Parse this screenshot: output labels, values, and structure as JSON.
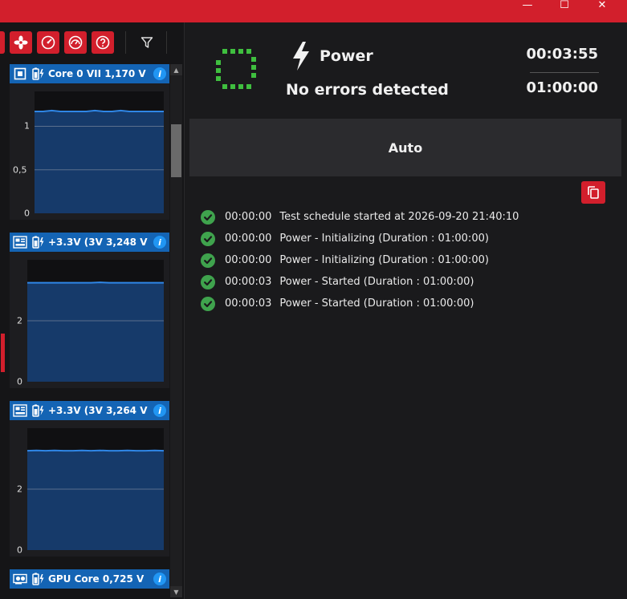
{
  "window": {
    "minimize_glyph": "—",
    "maximize_glyph": "☐",
    "close_glyph": "✕"
  },
  "toolbar": {
    "buttons": [
      "fan-icon",
      "gauge-icon",
      "dashboard-icon",
      "help-icon"
    ],
    "filter_icon": "filter-icon"
  },
  "sensors": [
    {
      "label": "Core 0 VII 1,170 V",
      "type_icon": "cpu-icon",
      "yticks": [
        "1",
        "0,5",
        "0"
      ],
      "ymax": 1.4,
      "values": [
        1.17,
        1.17,
        1.18,
        1.17,
        1.17,
        1.17,
        1.17,
        1.18,
        1.17,
        1.17,
        1.18,
        1.17,
        1.17,
        1.17,
        1.17,
        1.17
      ]
    },
    {
      "label": "+3.3V (3V 3,248 V",
      "type_icon": "motherboard-icon",
      "yticks": [
        "2",
        "0"
      ],
      "ymax": 4.0,
      "values": [
        3.248,
        3.248,
        3.248,
        3.248,
        3.248,
        3.248,
        3.248,
        3.248,
        3.26,
        3.248,
        3.248,
        3.248,
        3.248,
        3.248,
        3.248,
        3.248
      ]
    },
    {
      "label": "+3.3V (3V 3,264 V",
      "type_icon": "motherboard-icon",
      "yticks": [
        "2",
        "0"
      ],
      "ymax": 4.0,
      "values": [
        3.26,
        3.27,
        3.26,
        3.27,
        3.26,
        3.26,
        3.27,
        3.26,
        3.27,
        3.26,
        3.26,
        3.27,
        3.26,
        3.26,
        3.27,
        3.26
      ]
    },
    {
      "label": "GPU Core 0,725 V",
      "type_icon": "gpu-icon"
    }
  ],
  "test": {
    "name": "Power",
    "status": "No errors detected",
    "elapsed": "00:03:55",
    "total": "01:00:00",
    "mode": "Auto"
  },
  "log": [
    {
      "time": "00:00:00",
      "message": "Test schedule started at 2026-09-20 21:40:10"
    },
    {
      "time": "00:00:00",
      "message": "Power - Initializing (Duration : 01:00:00)"
    },
    {
      "time": "00:00:00",
      "message": "Power - Initializing (Duration : 01:00:00)"
    },
    {
      "time": "00:00:03",
      "message": "Power - Started (Duration : 01:00:00)"
    },
    {
      "time": "00:00:03",
      "message": "Power - Started (Duration : 01:00:00)"
    }
  ],
  "colors": {
    "accent": "#d21f2c",
    "header_blue": "#1464b4",
    "chart_fill": "#163a6a",
    "chart_line": "#2f86e6",
    "success": "#3fa34d",
    "status_dots": "#3fbf3f"
  }
}
